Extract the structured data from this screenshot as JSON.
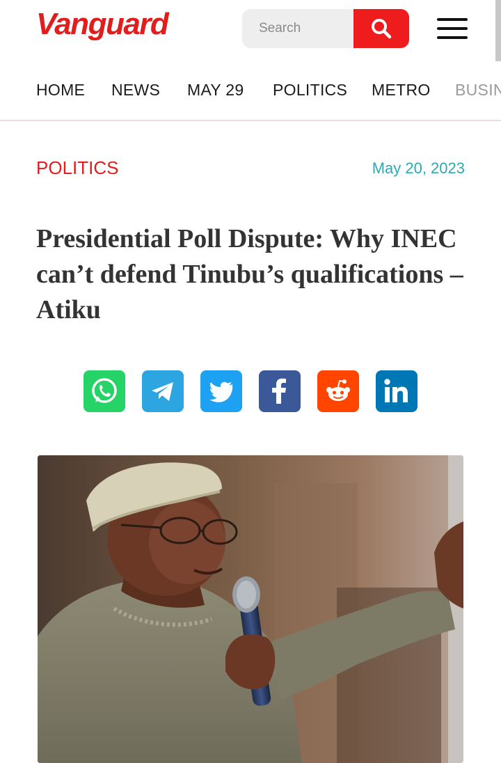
{
  "header": {
    "logo_text": "Vanguard",
    "search_placeholder": "Search",
    "search_icon": "search-icon",
    "menu_icon": "hamburger-icon"
  },
  "nav": {
    "items": [
      {
        "label": "HOME"
      },
      {
        "label": "NEWS"
      },
      {
        "label": "MAY 29"
      },
      {
        "label": "POLITICS"
      },
      {
        "label": "METRO"
      },
      {
        "label": "BUSIN"
      }
    ]
  },
  "article": {
    "category": "POLITICS",
    "date": "May 20, 2023",
    "headline": "Presidential Poll Dispute: Why INEC can’t defend Tinubu’s qualifications – Atiku"
  },
  "share": [
    {
      "icon": "whatsapp-icon",
      "color": "#25d366"
    },
    {
      "icon": "telegram-icon",
      "color": "#2ca5e0"
    },
    {
      "icon": "twitter-icon",
      "color": "#1da1f2"
    },
    {
      "icon": "facebook-icon",
      "color": "#3b5998"
    },
    {
      "icon": "reddit-icon",
      "color": "#ff4500"
    },
    {
      "icon": "linkedin-icon",
      "color": "#0077b5"
    }
  ],
  "colors": {
    "brand_red": "#e11d1d",
    "date_teal": "#2ba9b4"
  }
}
